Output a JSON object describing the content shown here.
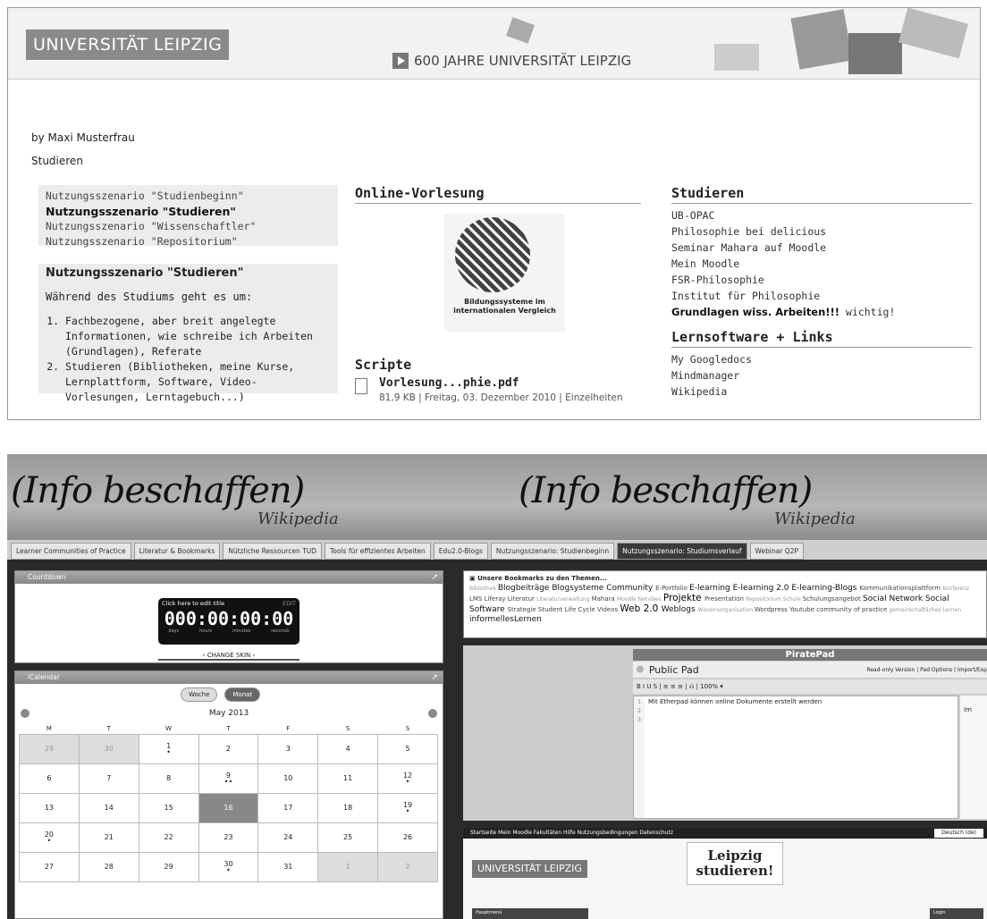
{
  "top": {
    "logo": "UNIVERSITÄT LEIPZIG",
    "banner_link": "600 JAHRE UNIVERSITÄT LEIPZIG",
    "byline_prefix": "by",
    "author": "Maxi Musterfrau",
    "breadcrumb": "Studieren",
    "nav_items": [
      {
        "label": "Nutzungsszenario \"Studienbeginn\"",
        "active": false
      },
      {
        "label": "Nutzungsszenario \"Studieren\"",
        "active": true
      },
      {
        "label": "Nutzungsszenario \"Wissenschaftler\"",
        "active": false
      },
      {
        "label": "Nutzungsszenario \"Repositorium\"",
        "active": false
      }
    ],
    "description": {
      "title": "Nutzungsszenario \"Studieren\"",
      "intro": "Während des Studiums geht es um:",
      "items": [
        "Fachbezogene, aber breit angelegte Informationen, wie schreibe ich Arbeiten (Grundlagen), Referate",
        "Studieren (Bibliotheken, meine Kurse, Lernplattform, Software, Video-Vorlesungen, Lerntagebuch...)"
      ]
    },
    "online_vorlesung": {
      "title": "Online-Vorlesung",
      "image_caption": "Bildungssysteme im internationalen Vergleich"
    },
    "scripte": {
      "title": "Scripte",
      "file_name": "Vorlesung...phie.pdf",
      "file_meta": "81,9 KB | Freitag, 03. Dezember 2010 | Einzelheiten"
    },
    "studieren": {
      "title": "Studieren",
      "links": [
        "UB-OPAC",
        "Philosophie bei delicious",
        "Seminar Mahara auf Moodle",
        "Mein Moodle",
        "FSR-Philosophie",
        "Institut für Philosophie"
      ],
      "bold_link": "Grundlagen wiss. Arbeiten!!!",
      "bold_suffix": "wichtig!"
    },
    "lernsoftware": {
      "title": "Lernsoftware + Links",
      "links": [
        "My Googledocs",
        "Mindmanager",
        "Wikipedia"
      ]
    }
  },
  "bottom": {
    "hero_text": "(Info beschaffen)",
    "hero_sub": "Wikipedia",
    "tabs": [
      {
        "label": "Learner Communities of Practice",
        "active": false
      },
      {
        "label": "Literatur & Bookmarks",
        "active": false
      },
      {
        "label": "Nützliche Ressourcen TUD",
        "active": false
      },
      {
        "label": "Tools für effizientes Arbeiten",
        "active": false
      },
      {
        "label": "Edu2.0-Blogs",
        "active": false
      },
      {
        "label": "Nutzungsszenario: Studienbeginn",
        "active": false
      },
      {
        "label": "Nutzungsszenario: Studiumsverlauf",
        "active": true
      },
      {
        "label": "Webinar Q2P",
        "active": false
      }
    ],
    "countdown": {
      "header": "Countdown",
      "edit_title": "Click here to edit title",
      "edit_link": "EDIT",
      "digits": "000:00:00:00",
      "units": [
        "days",
        "hours",
        "minutes",
        "seconds"
      ],
      "skin_label": "‹ CHANGE SKIN ›"
    },
    "calendar": {
      "header": "iCalendar",
      "toggle_week": "Woche",
      "toggle_month": "Monat",
      "month": "May 2013",
      "weekdays": [
        "M",
        "T",
        "W",
        "T",
        "F",
        "S",
        "S"
      ],
      "weeks": [
        [
          {
            "d": "29",
            "dim": true
          },
          {
            "d": "30",
            "dim": true
          },
          {
            "d": "1",
            "dots": "•"
          },
          {
            "d": "2"
          },
          {
            "d": "3"
          },
          {
            "d": "4"
          },
          {
            "d": "5"
          }
        ],
        [
          {
            "d": "6"
          },
          {
            "d": "7"
          },
          {
            "d": "8"
          },
          {
            "d": "9",
            "dots": "••"
          },
          {
            "d": "10"
          },
          {
            "d": "11"
          },
          {
            "d": "12",
            "dots": "•"
          }
        ],
        [
          {
            "d": "13"
          },
          {
            "d": "14"
          },
          {
            "d": "15"
          },
          {
            "d": "16",
            "today": true
          },
          {
            "d": "17"
          },
          {
            "d": "18"
          },
          {
            "d": "19",
            "dots": "•"
          }
        ],
        [
          {
            "d": "20",
            "dots": "•"
          },
          {
            "d": "21"
          },
          {
            "d": "22"
          },
          {
            "d": "23"
          },
          {
            "d": "24"
          },
          {
            "d": "25"
          },
          {
            "d": "26"
          }
        ],
        [
          {
            "d": "27"
          },
          {
            "d": "28"
          },
          {
            "d": "29"
          },
          {
            "d": "30",
            "dots": "•"
          },
          {
            "d": "31"
          },
          {
            "d": "1",
            "dim": true
          },
          {
            "d": "2",
            "dim": true
          }
        ]
      ]
    },
    "bookmarks": {
      "title": "Unsere Bookmarks zu den Themen...",
      "tags": [
        {
          "t": "Bibliothek",
          "s": 1
        },
        {
          "t": "Blogbeiträge",
          "s": 3
        },
        {
          "t": "Blogsysteme",
          "s": 3
        },
        {
          "t": "Community",
          "s": 3
        },
        {
          "t": "E-Portfolio",
          "s": 2
        },
        {
          "t": "E-learning",
          "s": 3
        },
        {
          "t": "E-learning 2.0",
          "s": 3
        },
        {
          "t": "E-learning-Blogs",
          "s": 3
        },
        {
          "t": "Kommunikationsplattform",
          "s": 2
        },
        {
          "t": "Konferenz",
          "s": 1
        },
        {
          "t": "LMS",
          "s": 2
        },
        {
          "t": "Liferay",
          "s": 2
        },
        {
          "t": "Literatur",
          "s": 2
        },
        {
          "t": "Literaturverwaltung",
          "s": 1
        },
        {
          "t": "Mahara",
          "s": 2
        },
        {
          "t": "Moodle",
          "s": 1
        },
        {
          "t": "Netvibes",
          "s": 1
        },
        {
          "t": "Projekte",
          "s": 4
        },
        {
          "t": "Presentation",
          "s": 2
        },
        {
          "t": "Repositorium",
          "s": 1
        },
        {
          "t": "Schule",
          "s": 1
        },
        {
          "t": "Schulungsangebot",
          "s": 2
        },
        {
          "t": "Social Network",
          "s": 3
        },
        {
          "t": "Social Software",
          "s": 3
        },
        {
          "t": "Strategie",
          "s": 2
        },
        {
          "t": "Student Life Cycle",
          "s": 2
        },
        {
          "t": "Videos",
          "s": 2
        },
        {
          "t": "Web 2.0",
          "s": 4
        },
        {
          "t": "Weblogs",
          "s": 3
        },
        {
          "t": "Wissensorganisation",
          "s": 1
        },
        {
          "t": "Wordpress",
          "s": 2
        },
        {
          "t": "Youtube",
          "s": 2
        },
        {
          "t": "community of practice",
          "s": 2
        },
        {
          "t": "gemeinschaftliches Lernen",
          "s": 1
        },
        {
          "t": "informellesLernen",
          "s": 3
        }
      ]
    },
    "piratepad": {
      "header": "PiratePad",
      "pad_title": "Public Pad",
      "options": "Read-only Version | Pad Options | Import/Exp",
      "toolbar": "B  I  U  S  |  ≡  ≡  ≡  |  ⎌  |  100%  ▾",
      "text": "Mit Etherpad können online Dokumente erstellt werden",
      "line_numbers": [
        "1",
        "2",
        "3"
      ],
      "side_label": "Im"
    },
    "moodle": {
      "menu_bar": "Startseite   Mein Moodle   Fakultäten   Hilfe   Nutzungsbedingungen   Datenschutz",
      "language": "Deutsch (de)",
      "logo": "UNIVERSITÄT LEIPZIG",
      "promo": "Leipzig studieren!",
      "main_menu": "Hauptmenü",
      "login": "Login"
    }
  }
}
